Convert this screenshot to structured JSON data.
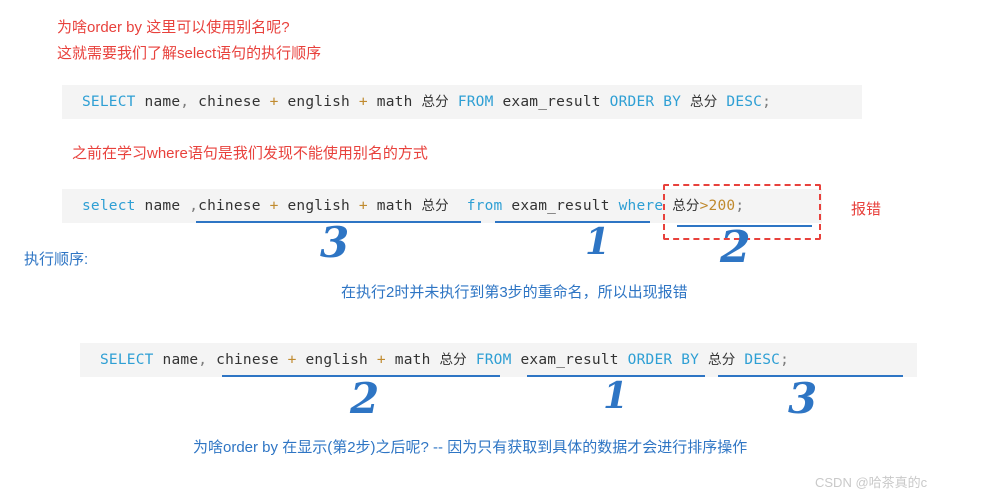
{
  "colors": {
    "red": "#e8413c",
    "blue": "#2e75c4",
    "code_bg": "#f4f4f4",
    "keyword": "#2e9fd4",
    "operator": "#c08a2e",
    "watermark": "#c9c9c9"
  },
  "notes": {
    "top_line1": "为啥order by 这里可以使用别名呢?",
    "top_line2": "这就需要我们了解select语句的执行顺序",
    "mid_note": "之前在学习where语句是我们发现不能使用别名的方式",
    "error_label": "报错",
    "exec_order_label": "执行顺序:",
    "explain_note": "在执行2时并未执行到第3步的重命名，所以出现报错",
    "bottom_note": "为啥order by 在显示(第2步)之后呢?  -- 因为只有获取到具体的数据才会进行排序操作"
  },
  "code_blocks": [
    {
      "id": "code-block-1",
      "full_text": "SELECT name, chinese + english + math 总分 FROM exam_result ORDER BY 总分 DESC;",
      "tokens": [
        {
          "t": "SELECT",
          "k": "kw"
        },
        {
          "t": " ",
          "k": "sp"
        },
        {
          "t": "name",
          "k": "id"
        },
        {
          "t": ",",
          "k": "pun"
        },
        {
          "t": " ",
          "k": "sp"
        },
        {
          "t": "chinese",
          "k": "id"
        },
        {
          "t": " ",
          "k": "sp"
        },
        {
          "t": "+",
          "k": "op"
        },
        {
          "t": " ",
          "k": "sp"
        },
        {
          "t": "english",
          "k": "id"
        },
        {
          "t": " ",
          "k": "sp"
        },
        {
          "t": "+",
          "k": "op"
        },
        {
          "t": " ",
          "k": "sp"
        },
        {
          "t": "math",
          "k": "id"
        },
        {
          "t": " ",
          "k": "sp"
        },
        {
          "t": "总分",
          "k": "cjk"
        },
        {
          "t": " ",
          "k": "sp"
        },
        {
          "t": "FROM",
          "k": "kw"
        },
        {
          "t": " ",
          "k": "sp"
        },
        {
          "t": "exam_result",
          "k": "id"
        },
        {
          "t": " ",
          "k": "sp"
        },
        {
          "t": "ORDER BY",
          "k": "kw"
        },
        {
          "t": " ",
          "k": "sp"
        },
        {
          "t": "总分",
          "k": "cjk"
        },
        {
          "t": " ",
          "k": "sp"
        },
        {
          "t": "DESC",
          "k": "kw"
        },
        {
          "t": ";",
          "k": "pun"
        }
      ]
    },
    {
      "id": "code-block-2",
      "full_text": "select name ,chinese + english + math 总分 from exam_result where 总分>200;",
      "tokens": [
        {
          "t": "select",
          "k": "kw"
        },
        {
          "t": " ",
          "k": "sp"
        },
        {
          "t": "name",
          "k": "id"
        },
        {
          "t": " ",
          "k": "sp"
        },
        {
          "t": ",",
          "k": "pun"
        },
        {
          "t": "chinese",
          "k": "id"
        },
        {
          "t": " ",
          "k": "sp"
        },
        {
          "t": "+",
          "k": "op"
        },
        {
          "t": " ",
          "k": "sp"
        },
        {
          "t": "english",
          "k": "id"
        },
        {
          "t": " ",
          "k": "sp"
        },
        {
          "t": "+",
          "k": "op"
        },
        {
          "t": " ",
          "k": "sp"
        },
        {
          "t": "math",
          "k": "id"
        },
        {
          "t": " ",
          "k": "sp"
        },
        {
          "t": "总分",
          "k": "cjk"
        },
        {
          "t": "  ",
          "k": "sp"
        },
        {
          "t": "from",
          "k": "kw"
        },
        {
          "t": " ",
          "k": "sp"
        },
        {
          "t": "exam_result",
          "k": "id"
        },
        {
          "t": " ",
          "k": "sp"
        },
        {
          "t": "where",
          "k": "kw"
        },
        {
          "t": " ",
          "k": "sp"
        },
        {
          "t": "总分",
          "k": "cjk"
        },
        {
          "t": ">",
          "k": "op"
        },
        {
          "t": "200",
          "k": "num"
        },
        {
          "t": ";",
          "k": "pun"
        }
      ]
    },
    {
      "id": "code-block-3",
      "full_text": "SELECT name, chinese + english + math 总分 FROM exam_result ORDER BY 总分 DESC;",
      "tokens": [
        {
          "t": "SELECT",
          "k": "kw"
        },
        {
          "t": " ",
          "k": "sp"
        },
        {
          "t": "name",
          "k": "id"
        },
        {
          "t": ",",
          "k": "pun"
        },
        {
          "t": " ",
          "k": "sp"
        },
        {
          "t": "chinese",
          "k": "id"
        },
        {
          "t": " ",
          "k": "sp"
        },
        {
          "t": "+",
          "k": "op"
        },
        {
          "t": " ",
          "k": "sp"
        },
        {
          "t": "english",
          "k": "id"
        },
        {
          "t": " ",
          "k": "sp"
        },
        {
          "t": "+",
          "k": "op"
        },
        {
          "t": " ",
          "k": "sp"
        },
        {
          "t": "math",
          "k": "id"
        },
        {
          "t": " ",
          "k": "sp"
        },
        {
          "t": "总分",
          "k": "cjk"
        },
        {
          "t": " ",
          "k": "sp"
        },
        {
          "t": "FROM",
          "k": "kw"
        },
        {
          "t": " ",
          "k": "sp"
        },
        {
          "t": "exam_result",
          "k": "id"
        },
        {
          "t": " ",
          "k": "sp"
        },
        {
          "t": "ORDER BY",
          "k": "kw"
        },
        {
          "t": " ",
          "k": "sp"
        },
        {
          "t": "总分",
          "k": "cjk"
        },
        {
          "t": " ",
          "k": "sp"
        },
        {
          "t": "DESC",
          "k": "kw"
        },
        {
          "t": ";",
          "k": "pun"
        }
      ]
    }
  ],
  "step_markers": {
    "block2": [
      "3",
      "1",
      "2"
    ],
    "block3": [
      "2",
      "1",
      "3"
    ]
  },
  "watermark": "CSDN @哈茶真的c"
}
